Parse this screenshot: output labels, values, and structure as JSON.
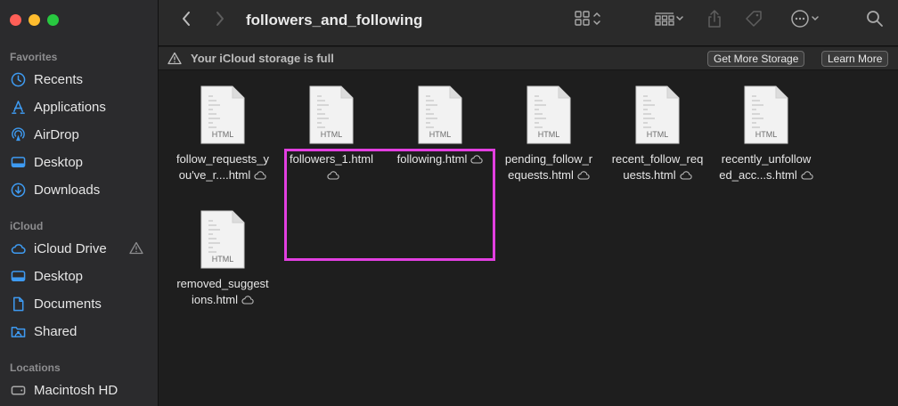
{
  "window": {
    "title": "followers_and_following"
  },
  "sidebar": {
    "sections": [
      {
        "label": "Favorites"
      },
      {
        "label": "iCloud"
      },
      {
        "label": "Locations"
      }
    ],
    "items": [
      {
        "label": "Recents",
        "icon": "clock-icon"
      },
      {
        "label": "Applications",
        "icon": "applications-icon"
      },
      {
        "label": "AirDrop",
        "icon": "airdrop-icon"
      },
      {
        "label": "Desktop",
        "icon": "desktop-icon"
      },
      {
        "label": "Downloads",
        "icon": "download-icon"
      },
      {
        "label": "iCloud Drive",
        "icon": "cloud-icon"
      },
      {
        "label": "Desktop",
        "icon": "desktop-icon"
      },
      {
        "label": "Documents",
        "icon": "document-icon"
      },
      {
        "label": "Shared",
        "icon": "shared-folder-icon"
      },
      {
        "label": "Macintosh HD",
        "icon": "disk-icon"
      }
    ]
  },
  "banner": {
    "message": "Your iCloud storage is full",
    "get_more_label": "Get More Storage",
    "learn_more_label": "Learn More"
  },
  "files": [
    {
      "line1": "follow_requests_y",
      "line2": "ou've_r....html",
      "type": "HTML"
    },
    {
      "line1": "followers_1.html",
      "line2": "",
      "type": "HTML"
    },
    {
      "line1": "following.html",
      "line2": "",
      "type": "HTML"
    },
    {
      "line1": "pending_follow_r",
      "line2": "equests.html",
      "type": "HTML"
    },
    {
      "line1": "recent_follow_req",
      "line2": "uests.html",
      "type": "HTML"
    },
    {
      "line1": "recently_unfollow",
      "line2": "ed_acc...s.html",
      "type": "HTML"
    },
    {
      "line1": "removed_suggest",
      "line2": "ions.html",
      "type": "HTML"
    }
  ],
  "colors": {
    "highlight": "#e23fe0",
    "accent": "#3e9bf2"
  }
}
